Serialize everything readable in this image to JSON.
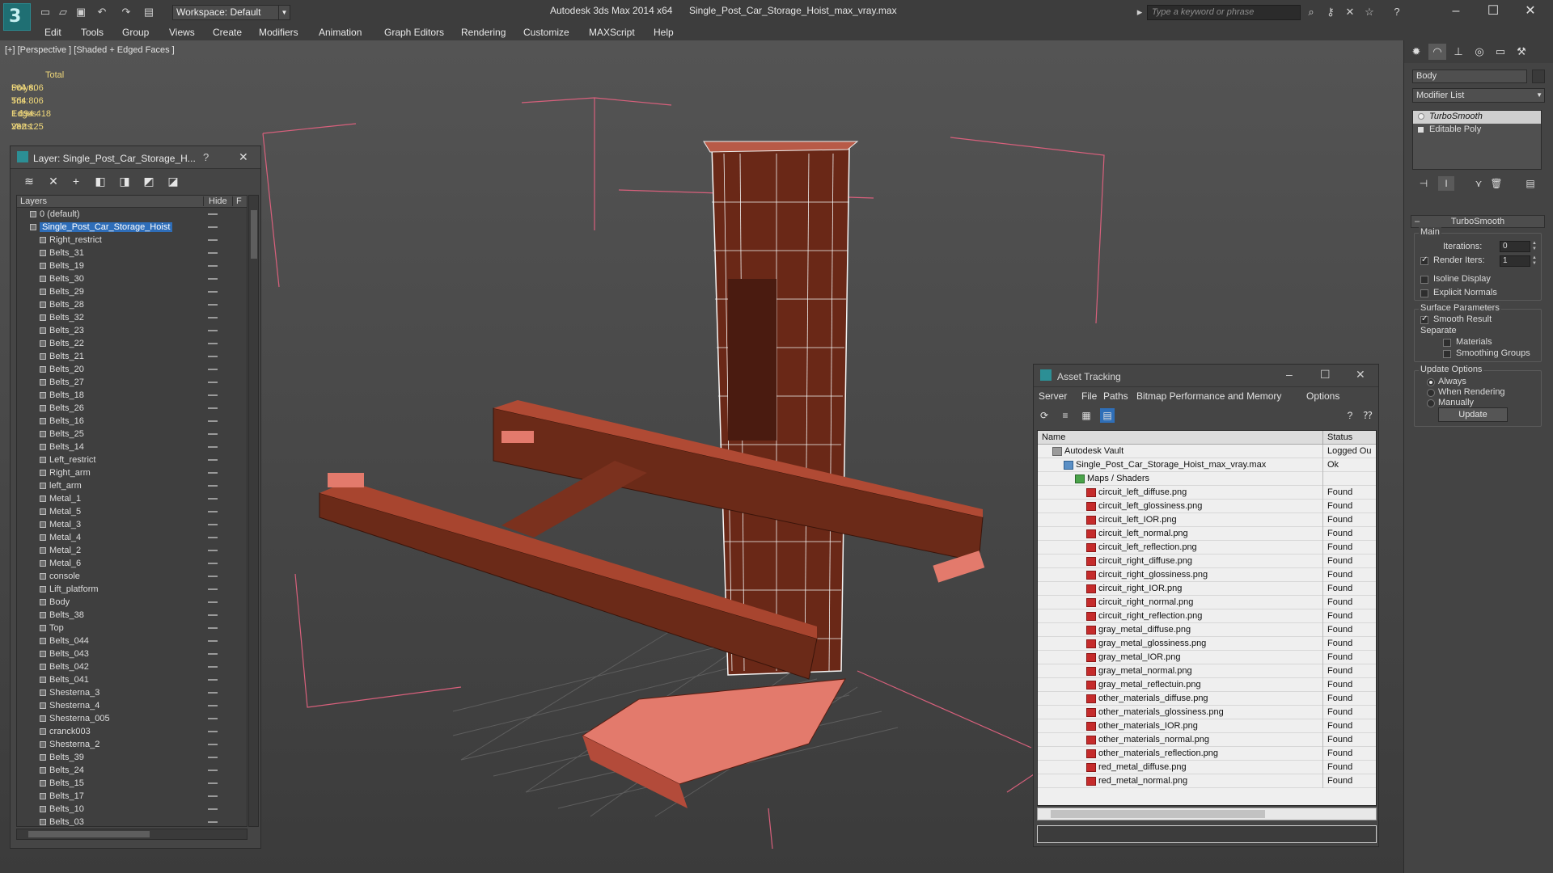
{
  "titlebar": {
    "workspace": "Workspace: Default",
    "app_title": "Autodesk 3ds Max  2014 x64",
    "doc_title": "Single_Post_Car_Storage_Hoist_max_vray.max",
    "search_placeholder": "Type a keyword or phrase"
  },
  "menu": [
    "Edit",
    "Tools",
    "Group",
    "Views",
    "Create",
    "Modifiers",
    "Animation",
    "Graph Editors",
    "Rendering",
    "Customize",
    "MAXScript",
    "Help"
  ],
  "viewport": {
    "label": "[+] [Perspective ] [Shaded + Edged Faces ]",
    "stats": {
      "total_label": "Total",
      "rows": [
        {
          "label": "Polys:",
          "value": "564 806"
        },
        {
          "label": "Tris:",
          "value": "564 806"
        },
        {
          "label": "Edges:",
          "value": "1 694 418"
        },
        {
          "label": "Verts:",
          "value": "282 125"
        }
      ]
    }
  },
  "layer_panel": {
    "title": "Layer: Single_Post_Car_Storage_H...",
    "help": "?",
    "columns": {
      "layers": "Layers",
      "hide": "Hide",
      "freeze": "F"
    },
    "items": [
      {
        "name": "0 (default)",
        "level": 0,
        "selected": false
      },
      {
        "name": "Single_Post_Car_Storage_Hoist",
        "level": 0,
        "selected": true
      },
      {
        "name": "Right_restrict",
        "level": 1
      },
      {
        "name": "Belts_31",
        "level": 1
      },
      {
        "name": "Belts_19",
        "level": 1
      },
      {
        "name": "Belts_30",
        "level": 1
      },
      {
        "name": "Belts_29",
        "level": 1
      },
      {
        "name": "Belts_28",
        "level": 1
      },
      {
        "name": "Belts_32",
        "level": 1
      },
      {
        "name": "Belts_23",
        "level": 1
      },
      {
        "name": "Belts_22",
        "level": 1
      },
      {
        "name": "Belts_21",
        "level": 1
      },
      {
        "name": "Belts_20",
        "level": 1
      },
      {
        "name": "Belts_27",
        "level": 1
      },
      {
        "name": "Belts_18",
        "level": 1
      },
      {
        "name": "Belts_26",
        "level": 1
      },
      {
        "name": "Belts_16",
        "level": 1
      },
      {
        "name": "Belts_25",
        "level": 1
      },
      {
        "name": "Belts_14",
        "level": 1
      },
      {
        "name": "Left_restrict",
        "level": 1
      },
      {
        "name": "Right_arm",
        "level": 1
      },
      {
        "name": "left_arm",
        "level": 1
      },
      {
        "name": "Metal_1",
        "level": 1
      },
      {
        "name": "Metal_5",
        "level": 1
      },
      {
        "name": "Metal_3",
        "level": 1
      },
      {
        "name": "Metal_4",
        "level": 1
      },
      {
        "name": "Metal_2",
        "level": 1
      },
      {
        "name": "Metal_6",
        "level": 1
      },
      {
        "name": "console",
        "level": 1
      },
      {
        "name": "Lift_platform",
        "level": 1
      },
      {
        "name": "Body",
        "level": 1
      },
      {
        "name": "Belts_38",
        "level": 1
      },
      {
        "name": "Top",
        "level": 1
      },
      {
        "name": "Belts_044",
        "level": 1
      },
      {
        "name": "Belts_043",
        "level": 1
      },
      {
        "name": "Belts_042",
        "level": 1
      },
      {
        "name": "Belts_041",
        "level": 1
      },
      {
        "name": "Shesterna_3",
        "level": 1
      },
      {
        "name": "Shesterna_4",
        "level": 1
      },
      {
        "name": "Shesterna_005",
        "level": 1
      },
      {
        "name": "cranck003",
        "level": 1
      },
      {
        "name": "Shesterna_2",
        "level": 1
      },
      {
        "name": "Belts_39",
        "level": 1
      },
      {
        "name": "Belts_24",
        "level": 1
      },
      {
        "name": "Belts_15",
        "level": 1
      },
      {
        "name": "Belts_17",
        "level": 1
      },
      {
        "name": "Belts_10",
        "level": 1
      },
      {
        "name": "Belts_03",
        "level": 1
      }
    ]
  },
  "asset_panel": {
    "title": "Asset Tracking",
    "menu": [
      "Server",
      "File",
      "Paths",
      "Bitmap Performance and Memory",
      "Options"
    ],
    "columns": {
      "name": "Name",
      "status": "Status"
    },
    "rows": [
      {
        "name": "Autodesk Vault",
        "status": "Logged Ou",
        "type": "vault",
        "indent": 1
      },
      {
        "name": "Single_Post_Car_Storage_Hoist_max_vray.max",
        "status": "Ok",
        "type": "max",
        "indent": 2
      },
      {
        "name": "Maps / Shaders",
        "status": "",
        "type": "folder",
        "indent": 3
      },
      {
        "name": "circuit_left_diffuse.png",
        "status": "Found",
        "type": "png",
        "indent": 4
      },
      {
        "name": "circuit_left_glossiness.png",
        "status": "Found",
        "type": "png",
        "indent": 4
      },
      {
        "name": "circuit_left_IOR.png",
        "status": "Found",
        "type": "png",
        "indent": 4
      },
      {
        "name": "circuit_left_normal.png",
        "status": "Found",
        "type": "png",
        "indent": 4
      },
      {
        "name": "circuit_left_reflection.png",
        "status": "Found",
        "type": "png",
        "indent": 4
      },
      {
        "name": "circuit_right_diffuse.png",
        "status": "Found",
        "type": "png",
        "indent": 4
      },
      {
        "name": "circuit_right_glossiness.png",
        "status": "Found",
        "type": "png",
        "indent": 4
      },
      {
        "name": "circuit_right_IOR.png",
        "status": "Found",
        "type": "png",
        "indent": 4
      },
      {
        "name": "circuit_right_normal.png",
        "status": "Found",
        "type": "png",
        "indent": 4
      },
      {
        "name": "circuit_right_reflection.png",
        "status": "Found",
        "type": "png",
        "indent": 4
      },
      {
        "name": "gray_metal_diffuse.png",
        "status": "Found",
        "type": "png",
        "indent": 4
      },
      {
        "name": "gray_metal_glossiness.png",
        "status": "Found",
        "type": "png",
        "indent": 4
      },
      {
        "name": "gray_metal_IOR.png",
        "status": "Found",
        "type": "png",
        "indent": 4
      },
      {
        "name": "gray_metal_normal.png",
        "status": "Found",
        "type": "png",
        "indent": 4
      },
      {
        "name": "gray_metal_reflectuin.png",
        "status": "Found",
        "type": "png",
        "indent": 4
      },
      {
        "name": "other_materials_diffuse.png",
        "status": "Found",
        "type": "png",
        "indent": 4
      },
      {
        "name": "other_materials_glossiness.png",
        "status": "Found",
        "type": "png",
        "indent": 4
      },
      {
        "name": "other_materials_IOR.png",
        "status": "Found",
        "type": "png",
        "indent": 4
      },
      {
        "name": "other_materials_normal.png",
        "status": "Found",
        "type": "png",
        "indent": 4
      },
      {
        "name": "other_materials_reflection.png",
        "status": "Found",
        "type": "png",
        "indent": 4
      },
      {
        "name": "red_metal_diffuse.png",
        "status": "Found",
        "type": "png",
        "indent": 4
      },
      {
        "name": "red_metal_normal.png",
        "status": "Found",
        "type": "png",
        "indent": 4
      }
    ]
  },
  "command_panel": {
    "object_name": "Body",
    "modifier_list": "Modifier List",
    "stack": [
      {
        "name": "TurboSmooth",
        "selected": true
      },
      {
        "name": "Editable Poly",
        "selected": false
      }
    ],
    "rollout_title": "TurboSmooth",
    "main_label": "Main",
    "iterations_label": "Iterations:",
    "iterations_value": "0",
    "render_iters_label": "Render Iters:",
    "render_iters_value": "1",
    "render_iters_checked": true,
    "isoline_label": "Isoline Display",
    "explicit_normals_label": "Explicit Normals",
    "surface_params_label": "Surface Parameters",
    "smooth_result_label": "Smooth Result",
    "separate_label": "Separate",
    "materials_label": "Materials",
    "smoothing_groups_label": "Smoothing Groups",
    "update_options_label": "Update Options",
    "always_label": "Always",
    "when_rendering_label": "When Rendering",
    "manually_label": "Manually",
    "update_button": "Update"
  },
  "colors": {
    "accent_blue": "#2e6db8",
    "model_brown": "#6b2a18",
    "model_salmon": "#e37a6c",
    "gizmo_pink": "#e06080"
  }
}
